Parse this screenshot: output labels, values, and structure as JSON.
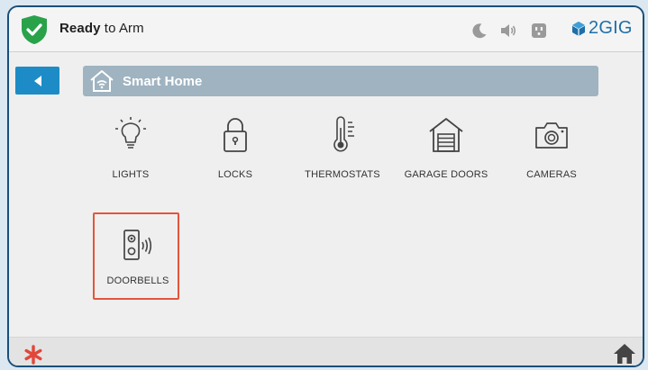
{
  "status": {
    "text_bold": "Ready",
    "text_rest": " to Arm",
    "shield_color": "#2aa24a"
  },
  "topbar_icons": [
    "moon-icon",
    "speaker-icon",
    "outlet-icon"
  ],
  "brand": {
    "text": "2GIG",
    "color": "#1e6fa8"
  },
  "nav": {
    "back_icon": "back-arrow-icon",
    "breadcrumb_label": "Smart Home",
    "breadcrumb_icon": "smart-home-icon"
  },
  "tiles": [
    {
      "label": "LIGHTS",
      "icon": "light-bulb-icon"
    },
    {
      "label": "LOCKS",
      "icon": "padlock-icon"
    },
    {
      "label": "THERMOSTATS",
      "icon": "thermometer-icon"
    },
    {
      "label": "GARAGE DOORS",
      "icon": "garage-icon"
    },
    {
      "label": "CAMERAS",
      "icon": "camera-icon"
    },
    {
      "label": "DOORBELLS",
      "icon": "doorbell-icon",
      "selected": true
    }
  ],
  "bottom": {
    "panic_icon": "panic-asterisk-icon",
    "panic_color": "#e2463a",
    "home_icon": "home-icon"
  }
}
